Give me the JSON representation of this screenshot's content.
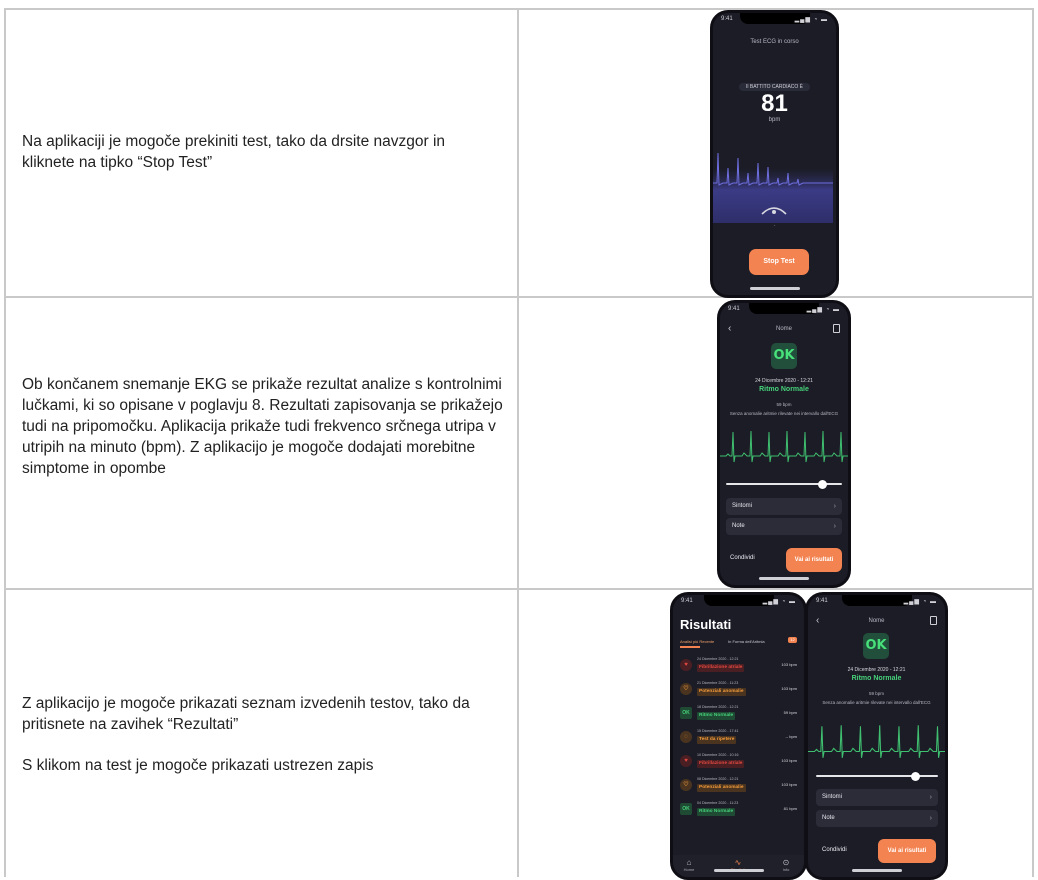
{
  "rows": [
    {
      "text": [
        "Na aplikaciji je mogoče prekiniti test, tako da drsite navzgor in kliknete na tipko “Stop Test”"
      ]
    },
    {
      "text": [
        "Ob končanem snemanje EKG se prikaže rezultat analize s kontrolnimi lučkami, ki so opisane v poglavju 8. Rezultati zapisovanja se prikažejo tudi na pripomočku. Aplikacija prikaže tudi frekvenco srčnega utripa v utripih na minuto (bpm). Z aplikacijo je mogoče dodajati morebitne simptome in opombe"
      ]
    },
    {
      "text": [
        "Z aplikacijo je mogoče prikazati seznam izvedenih testov, tako da pritisnete na zavihek “Rezultati”",
        "S klikom na test je mogoče prikazati ustrezen zapis"
      ]
    }
  ],
  "phone_test": {
    "time": "9:41",
    "status_icons": "▂▄▆ ◔ ▬",
    "title": "Test ECG in corso",
    "pill": "Il BATTITO CARDIACO È",
    "bpm": "81",
    "unit": "bpm",
    "stop_label": "Stop Test"
  },
  "phone_result": {
    "time": "9:41",
    "status_icons": "▂▄▆ ◔ ▬",
    "back": "‹",
    "title": "Nome",
    "badge": "OK",
    "date": "24 Dicembre 2020 - 12:21",
    "rhythm": "Ritmo Normale",
    "bpm": "59 bpm",
    "note": "Senza anomalie aritmie rilevate nei intervallo dall'ECG",
    "symptoms": "Sintomi",
    "notes": "Note",
    "share": "Condividi",
    "results_btn": "Vai ai risultati",
    "slider_value": 0.85
  },
  "phone_list": {
    "time": "9:41",
    "status_icons": "▂▄▆ ◔ ▬",
    "title": "Risultati",
    "tab_active": "Analisi più Recente",
    "tab_other": "In Forma dell'Aritmia",
    "tab_badge": "12",
    "items": [
      {
        "date": "24 Dicembre 2020 - 12:21",
        "label": "Fibrillazione atriale",
        "bpm": "103 bpm",
        "icon": "♥",
        "color": "#e2483f",
        "bg": "#4a1f24"
      },
      {
        "date": "21 Dicembre 2020 - 11:23",
        "label": "Potenziali anomalie",
        "bpm": "103 bpm",
        "icon": "♡",
        "color": "#f29a3a",
        "bg": "#4a3420"
      },
      {
        "date": "18 Dicembre 2020 - 12:21",
        "label": "Ritmo Normale",
        "bpm": "59 bpm",
        "icon": "OK",
        "color": "#47d27a",
        "bg": "#1f4a33"
      },
      {
        "date": "15 Dicembre 2020 - 17:41",
        "label": "Test da ripetere",
        "bpm": "-- bpm",
        "icon": "◌",
        "color": "#f29a3a",
        "bg": "#4a3420"
      },
      {
        "date": "10 Dicembre 2020 - 10:16",
        "label": "Fibrillazione atriale",
        "bpm": "103 bpm",
        "icon": "♥",
        "color": "#e2483f",
        "bg": "#4a1f24"
      },
      {
        "date": "08 Dicembre 2020 - 12:21",
        "label": "Potenziali anomalie",
        "bpm": "103 bpm",
        "icon": "♡",
        "color": "#f29a3a",
        "bg": "#4a3420"
      },
      {
        "date": "04 Dicembre 2020 - 11:23",
        "label": "Ritmo Normale",
        "bpm": "81 bpm",
        "icon": "OK",
        "color": "#47d27a",
        "bg": "#1f4a33"
      }
    ],
    "tabbar": [
      {
        "icon": "⌂",
        "label": "Home"
      },
      {
        "icon": "∿",
        "label": "Risultati"
      },
      {
        "icon": "⊙",
        "label": "Info"
      }
    ]
  },
  "accent": "#f38350",
  "ok_color": "#47d27a"
}
